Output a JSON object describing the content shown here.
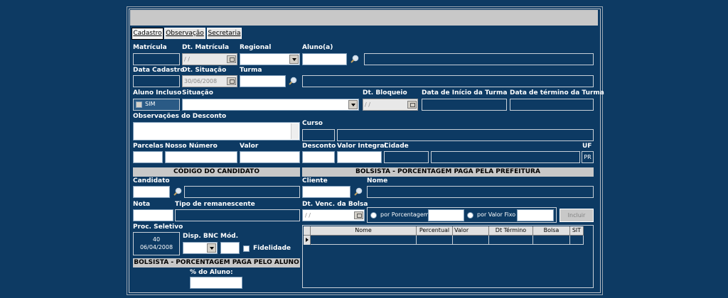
{
  "tabs": [
    "Cadastro",
    "Observação",
    "Secretaria"
  ],
  "labels": {
    "matricula": "Matrícula",
    "dt_matricula": "Dt. Matrícula",
    "regional": "Regional",
    "aluno": "Aluno(a)",
    "data_cadastro": "Data Cadastro",
    "dt_situacao": "Dt. Situação",
    "turma": "Turma",
    "aluno_incluso": "Aluno Incluso",
    "situacao": "Situação",
    "dt_bloqueio": "Dt. Bloqueio",
    "data_inicio_turma": "Data de Início da Turma",
    "data_termino_turma": "Data de término da Turma",
    "observacoes_desconto": "Observações do Desconto",
    "curso": "Curso",
    "parcelas": "Parcelas",
    "nosso_numero": "Nosso Número",
    "valor": "Valor",
    "desconto": "Desconto",
    "valor_integral": "Valor Integral",
    "cidade": "Cidade",
    "uf": "UF",
    "candidato": "Candidato",
    "cliente": "Cliente",
    "nome": "Nome",
    "nota": "Nota",
    "tipo_remanescente": "Tipo de remanescente",
    "dt_venc_bolsa": "Dt. Venc. da Bolsa",
    "proc_seletivo": "Proc. Seletivo",
    "disp_bnc": "Disp. BNC",
    "mod": "Mód.",
    "fidelidade": "Fidelidade",
    "pct_aluno": "% do Aluno:"
  },
  "values": {
    "dt_matricula": "/ /",
    "dt_situacao": "30/06/2008",
    "aluno_incluso_sim": "SIM",
    "dt_bloqueio": "/ /",
    "dt_venc_bolsa": "/ /",
    "proc_seletivo_num": "40",
    "proc_seletivo_date": "06/04/2008",
    "uf": "PR"
  },
  "sections": {
    "codigo_candidato": "CÓDIGO DO CANDIDATO",
    "bolsista_prefeitura": "BOLSISTA - PORCENTAGEM PAGA PELA PREFEITURA",
    "bolsista_aluno": "BOLSISTA - PORCENTAGEM PAGA PELO ALUNO"
  },
  "radios": {
    "por_porcentagem": "por Porcentagem",
    "por_valor_fixo": "por Valor Fixo"
  },
  "buttons": {
    "incluir": "Incluir"
  },
  "grid": {
    "columns": [
      "Nome",
      "Percentual",
      "Valor",
      "Dt Término",
      "Bolsa",
      "SIT"
    ]
  }
}
